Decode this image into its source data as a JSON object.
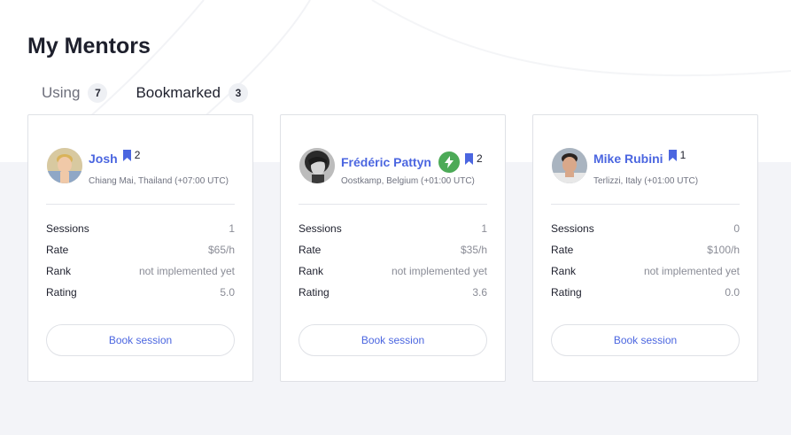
{
  "page": {
    "title": "My Mentors"
  },
  "tabs": [
    {
      "label": "Using",
      "count": "7",
      "active": false
    },
    {
      "label": "Bookmarked",
      "count": "3",
      "active": true
    }
  ],
  "stat_labels": {
    "sessions": "Sessions",
    "rate": "Rate",
    "rank": "Rank",
    "rating": "Rating"
  },
  "mentors": [
    {
      "name": "Josh",
      "bookmarks": "2",
      "location": "Chiang Mai, Thailand (+07:00 UTC)",
      "has_badge": false,
      "avatar_icon": "avatar-photo",
      "sessions": "1",
      "rate": "$65/h",
      "rank": "not implemented yet",
      "rating": "5.0",
      "book_label": "Book session"
    },
    {
      "name": "Frédéric Pattyn",
      "bookmarks": "2",
      "location": "Oostkamp, Belgium (+01:00 UTC)",
      "has_badge": true,
      "badge_icon": "lightning-icon",
      "avatar_icon": "avatar-photo",
      "sessions": "1",
      "rate": "$35/h",
      "rank": "not implemented yet",
      "rating": "3.6",
      "book_label": "Book session"
    },
    {
      "name": "Mike Rubini",
      "bookmarks": "1",
      "location": "Terlizzi, Italy (+01:00 UTC)",
      "has_badge": false,
      "avatar_icon": "avatar-photo",
      "sessions": "0",
      "rate": "$100/h",
      "rank": "not implemented yet",
      "rating": "0.0",
      "book_label": "Book session"
    }
  ],
  "colors": {
    "accent": "#4b66e0",
    "badge_green": "#4caa57",
    "background": "#f3f4f8"
  }
}
